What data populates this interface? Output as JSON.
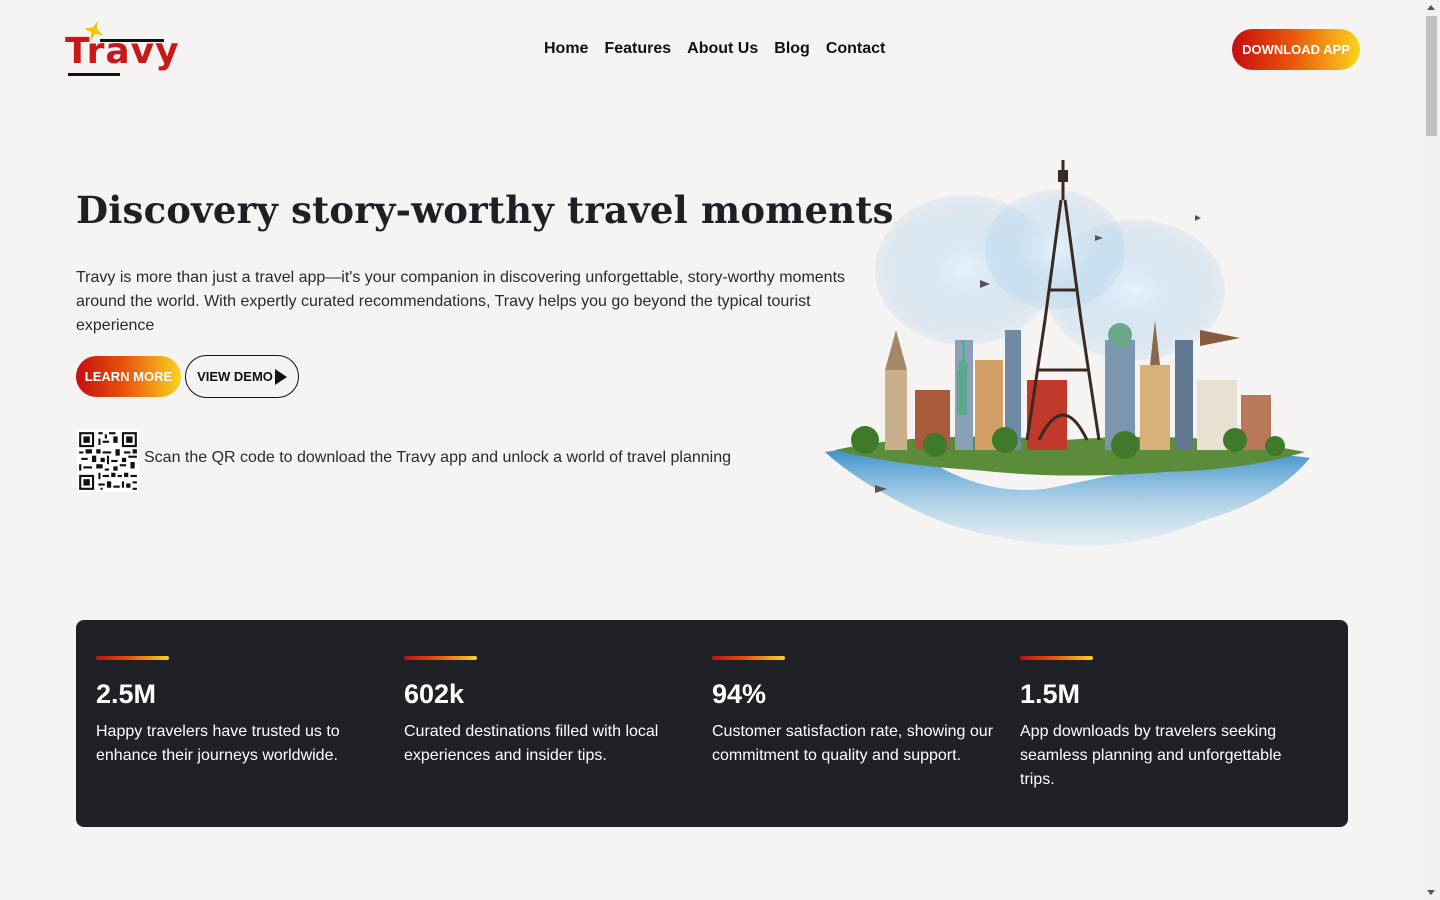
{
  "brand": {
    "logo_text": "Travy",
    "accent_red": "#c50d10",
    "accent_yellow": "#f9d51d"
  },
  "nav": {
    "items": [
      {
        "label": "Home"
      },
      {
        "label": "Features"
      },
      {
        "label": "About Us"
      },
      {
        "label": "Blog"
      },
      {
        "label": "Contact"
      }
    ],
    "download_label": "DOWNLOAD APP"
  },
  "hero": {
    "title": "Discovery story-worthy travel moments",
    "description": "Travy is more than just a travel app—it's your companion in discovering unforgettable, story-worthy moments around the world. With expertly curated recommendations, Travy helps you go beyond the typical tourist experience",
    "learn_more_label": "LEARN MORE",
    "view_demo_label": "VIEW DEMO",
    "qr_caption": "Scan the QR code to download the Travy app and unlock a world of travel planning"
  },
  "stats": [
    {
      "value": "2.5M",
      "description": "Happy travelers have trusted us to enhance their journeys worldwide."
    },
    {
      "value": "602k",
      "description": "Curated destinations filled with local experiences and insider tips."
    },
    {
      "value": "94%",
      "description": "Customer satisfaction rate, showing our commitment to quality and support."
    },
    {
      "value": "1.5M",
      "description": "App downloads by travelers seeking seamless planning and unforgettable trips."
    }
  ]
}
